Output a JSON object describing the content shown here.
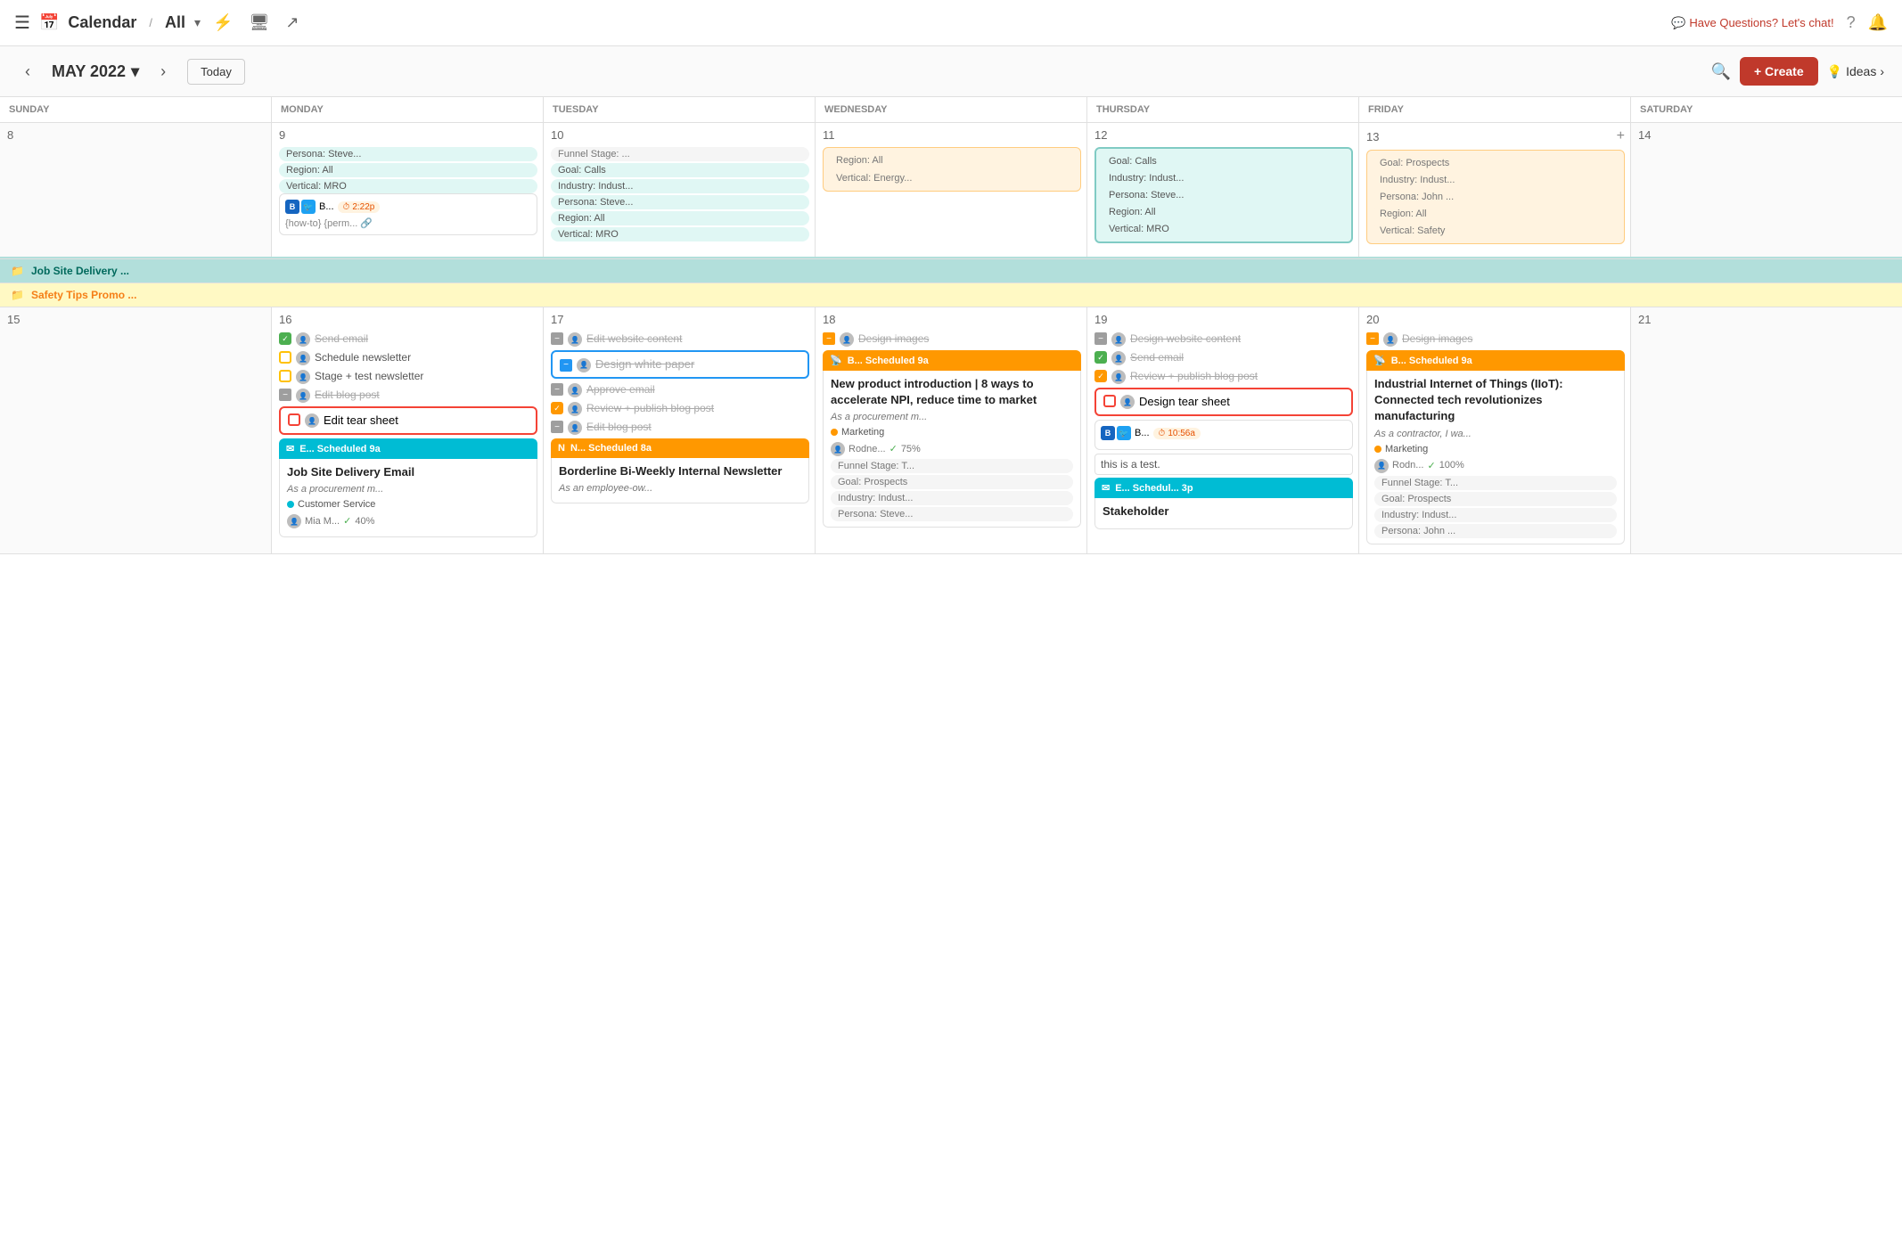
{
  "topNav": {
    "title": "Calendar",
    "separator": "/",
    "view": "All",
    "chatText": "Have Questions? Let's chat!",
    "helpIcon": "?",
    "bellIcon": "🔔"
  },
  "calHeader": {
    "prevBtn": "‹",
    "nextBtn": "›",
    "month": "MAY 2022",
    "chevron": "▾",
    "todayBtn": "Today",
    "createBtn": "+ Create",
    "ideasBtn": "Ideas"
  },
  "dayHeaders": [
    "SUNDAY",
    "MONDAY",
    "TUESDAY",
    "WEDNESDAY",
    "THURSDAY",
    "FRIDAY",
    "SATURDAY"
  ],
  "week1": {
    "days": [
      8,
      9,
      10,
      11,
      12,
      13,
      14
    ]
  },
  "week2Banner1": "Job Site Delivery ...",
  "week2Banner2": "Safety Tips Promo ...",
  "week2": {
    "days": [
      15,
      16,
      17,
      18,
      19,
      20,
      21
    ]
  },
  "events": {
    "mon9": {
      "chips": [
        "Persona: Steve...",
        "Region: All",
        "Vertical: MRO"
      ],
      "socialTime": "2:22p",
      "socialText": "{how-to} {perm..."
    },
    "tue10": {
      "chips": [
        "Funnel Stage: ...",
        "Goal: Calls",
        "Industry: Indust...",
        "Persona: Steve...",
        "Region: All",
        "Vertical: MRO"
      ]
    },
    "wed11": {
      "chips": [
        "Region: All",
        "Vertical: Energy..."
      ]
    },
    "thu12": {
      "chips": [
        "Goal: Calls",
        "Industry: Indust...",
        "Persona: Steve...",
        "Region: All",
        "Vertical: MRO"
      ]
    },
    "fri13": {
      "chips": [
        "Goal: Prospects",
        "Industry: Indust...",
        "Persona: John ...",
        "Region: All",
        "Vertical: Safety"
      ],
      "addIcon": "+"
    },
    "mon16": {
      "tasks": [
        {
          "type": "checked",
          "label": "Send email"
        },
        {
          "type": "square-yellow",
          "label": "Schedule newsletter"
        },
        {
          "type": "square-yellow",
          "label": "Stage + test newsletter"
        },
        {
          "type": "minus-gray",
          "label": "Edit blog post"
        },
        {
          "type": "square-red",
          "label": "Edit tear sheet"
        }
      ],
      "newsletterHeader": "E... Scheduled 9a",
      "newsletterTitle": "Job Site Delivery Email",
      "newsletterSub": "As a procurement m...",
      "newsletterTag": "Customer Service",
      "newsletterTagType": "teal",
      "newsletterMeta": "Mia M...",
      "newsletterProgress": 40
    },
    "tue17": {
      "tasks": [
        {
          "type": "minus-gray",
          "label": "Edit website content"
        },
        {
          "type": "minus-blue",
          "label": "Design white paper",
          "bordered": true
        },
        {
          "type": "minus-gray",
          "label": "Approve email"
        },
        {
          "type": "checked-orange",
          "label": "Review + publish blog post"
        },
        {
          "type": "minus-gray",
          "label": "Edit blog post"
        }
      ],
      "newsletterHeader": "N... Scheduled 8a",
      "newsletterTitle": "Borderline Bi-Weekly Internal Newsletter",
      "newsletterSub": "As an employee-ow..."
    },
    "wed18": {
      "tasks": [
        {
          "type": "minus-orange",
          "label": "Design images"
        }
      ],
      "newsletterHeader": "B... Scheduled 9a",
      "newsletterTitle": "New product introduction | 8 ways to accelerate NPI, reduce time to market",
      "newsletterSub": "As a procurement m...",
      "newsletterTag": "Marketing",
      "newsletterTagType": "orange",
      "newsletterMeta": "Rodne...",
      "newsletterProgress": 75,
      "chips": [
        "Funnel Stage: T...",
        "Goal: Prospects",
        "Industry: Indust...",
        "Persona: Steve..."
      ]
    },
    "thu19": {
      "tasks": [
        {
          "type": "minus-gray",
          "label": "Design website content"
        },
        {
          "type": "checked",
          "label": "Send email"
        },
        {
          "type": "checked-orange",
          "label": "Review + publish blog post"
        }
      ],
      "tearSheetCard": "Design tear sheet",
      "socialTime": "10:56a",
      "testNote": "this is a test.",
      "scheduledBanner": "E... Schedul... 3p",
      "scheduledTitle": "Stakeholder"
    },
    "fri20": {
      "tasks": [
        {
          "type": "minus-orange",
          "label": "Design images"
        }
      ],
      "newsletterHeader": "B... Scheduled 9a",
      "newsletterTitle": "Industrial Internet of Things (IIoT): Connected tech revolutionizes manufacturing",
      "newsletterSub": "As a contractor, I wa...",
      "newsletterTag": "Marketing",
      "newsletterTagType": "orange",
      "newsletterMeta": "Rodn...",
      "newsletterProgress": 100,
      "chips": [
        "Funnel Stage: T...",
        "Goal: Prospects",
        "Industry: Indust...",
        "Persona: John ..."
      ]
    }
  }
}
